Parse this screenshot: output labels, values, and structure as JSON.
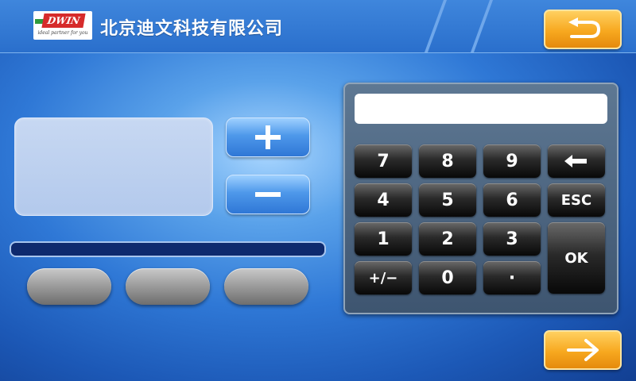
{
  "header": {
    "logo_text": "DWIN",
    "logo_tagline": "ideal partner for you",
    "company_name": "北京迪文科技有限公司"
  },
  "controls": {
    "plus_icon": "plus-icon",
    "minus_icon": "minus-icon",
    "back_icon": "undo-arrow-icon",
    "next_icon": "right-arrow-icon"
  },
  "progress": {
    "value": 0
  },
  "keypad": {
    "display_value": "",
    "keys": {
      "k7": "7",
      "k8": "8",
      "k9": "9",
      "backspace": "←",
      "k4": "4",
      "k5": "5",
      "k6": "6",
      "esc": "ESC",
      "k1": "1",
      "k2": "2",
      "k3": "3",
      "ok": "OK",
      "sign": "+/−",
      "k0": "0",
      "dot": "·"
    }
  },
  "colors": {
    "accent_orange": "#f7a81f",
    "header_blue": "#2a6fcc",
    "keypad_panel": "#4e6680"
  }
}
